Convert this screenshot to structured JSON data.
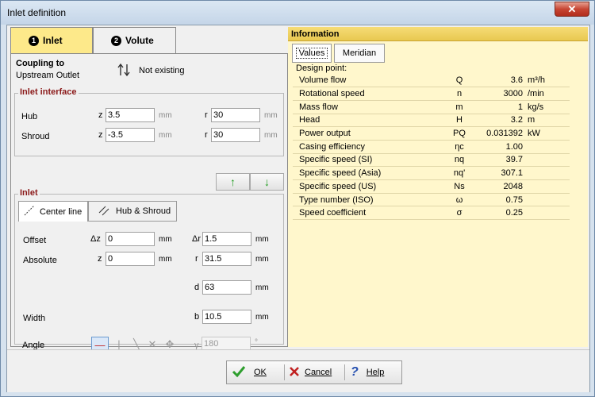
{
  "window": {
    "title": "Inlet definition",
    "close_glyph": "✕"
  },
  "tabs": [
    {
      "num": "1",
      "label": "Inlet"
    },
    {
      "num": "2",
      "label": "Volute"
    }
  ],
  "coupling": {
    "label_line1": "Coupling to",
    "label_line2": "Upstream Outlet",
    "icon": "swap-arrows-icon",
    "status": "Not existing"
  },
  "inlet_interface": {
    "title": "Inlet interface",
    "hub": {
      "label": "Hub",
      "z_sym": "z",
      "z_value": "3.5",
      "z_unit": "mm",
      "r_sym": "r",
      "r_value": "30",
      "r_unit": "mm"
    },
    "shroud": {
      "label": "Shroud",
      "z_sym": "z",
      "z_value": "-3.5",
      "z_unit": "mm",
      "r_sym": "r",
      "r_value": "30",
      "r_unit": "mm"
    }
  },
  "arrows": {
    "up": "↑",
    "down": "↓"
  },
  "inlet": {
    "title": "Inlet",
    "subtabs": [
      {
        "label": "Center line",
        "icon": "center-line-icon"
      },
      {
        "label": "Hub & Shroud",
        "icon": "hub-shroud-icon"
      }
    ],
    "offset": {
      "label": "Offset",
      "dz_sym": "Δz",
      "dz_value": "0",
      "dz_unit": "mm",
      "dr_sym": "Δr",
      "dr_value": "1.5",
      "dr_unit": "mm"
    },
    "absolute": {
      "label": "Absolute",
      "z_sym": "z",
      "z_value": "0",
      "z_unit": "mm",
      "r_sym": "r",
      "r_value": "31.5",
      "r_unit": "mm"
    },
    "diameter": {
      "d_sym": "d",
      "d_value": "63",
      "d_unit": "mm"
    },
    "width": {
      "label": "Width",
      "b_sym": "b",
      "b_value": "10.5",
      "b_unit": "mm"
    },
    "angle": {
      "label": "Angle",
      "gamma_sym": "γ",
      "gamma_value": "180",
      "gamma_unit": "°"
    }
  },
  "info": {
    "header": "Information",
    "tabs": [
      "Values",
      "Meridian"
    ],
    "design_point_label": "Design point:",
    "rows": [
      {
        "name": "Volume flow",
        "sym": "Q",
        "value": "3.6",
        "unit": "m³/h"
      },
      {
        "name": "Rotational speed",
        "sym": "n",
        "value": "3000",
        "unit": "/min"
      },
      {
        "name": "Mass flow",
        "sym": "m",
        "value": "1",
        "unit": "kg/s"
      },
      {
        "name": "Head",
        "sym": "H",
        "value": "3.2",
        "unit": "m"
      },
      {
        "name": "Power output",
        "sym": "PQ",
        "value": "0.031392",
        "unit": "kW"
      },
      {
        "name": "Casing efficiency",
        "sym": "ηc",
        "value": "1.00",
        "unit": ""
      },
      {
        "name": "Specific speed (SI)",
        "sym": "nq",
        "value": "39.7",
        "unit": ""
      },
      {
        "name": "Specific speed (Asia)",
        "sym": "nq'",
        "value": "307.1",
        "unit": ""
      },
      {
        "name": "Specific speed (US)",
        "sym": "Ns",
        "value": "2048",
        "unit": ""
      },
      {
        "name": "Type number (ISO)",
        "sym": "ω",
        "value": "0.75",
        "unit": ""
      },
      {
        "name": "Speed coefficient",
        "sym": "σ",
        "value": "0.25",
        "unit": ""
      }
    ]
  },
  "footer": {
    "ok": {
      "label": "OK",
      "icon": "checkmark-icon"
    },
    "cancel": {
      "label": "Cancel",
      "icon": "x-icon"
    },
    "help": {
      "label": "Help",
      "icon": "question-icon"
    }
  }
}
